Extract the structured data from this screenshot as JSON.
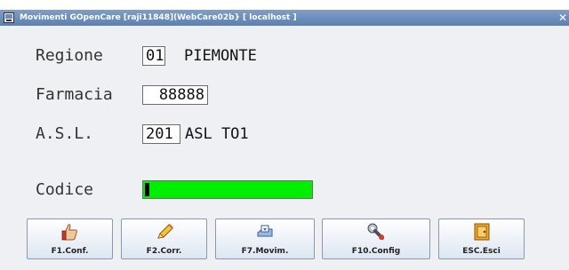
{
  "window": {
    "title": "Movimenti GOpenCare [raji11848](WebCare02b} [ localhost ]",
    "close_glyph": "✕",
    "icon": "app-icon"
  },
  "form": {
    "regione": {
      "label": "Regione",
      "code": "01",
      "description": "PIEMONTE"
    },
    "farmacia": {
      "label": "Farmacia",
      "code": "88888"
    },
    "asl": {
      "label": "A.S.L.",
      "code": "201",
      "description": "ASL TO1"
    },
    "codice": {
      "label": "Codice",
      "value": "",
      "field_color": "#00ee00"
    }
  },
  "toolbar": {
    "buttons": [
      {
        "label": "F1.Conf.",
        "icon": "thumbs-up-icon"
      },
      {
        "label": "F2.Corr.",
        "icon": "pencil-icon"
      },
      {
        "label": "F7.Movim.",
        "icon": "tray-icon"
      },
      {
        "label": "F10.Config",
        "icon": "wrench-icon"
      },
      {
        "label": "ESC.Esci",
        "icon": "exit-door-icon"
      }
    ]
  }
}
